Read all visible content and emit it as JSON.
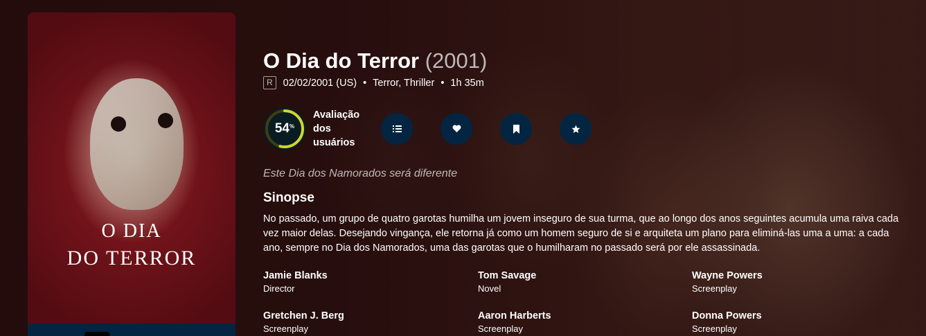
{
  "poster": {
    "title_line1": "O Dia",
    "title_line2": "do Terror"
  },
  "movie": {
    "title": "O Dia do Terror",
    "year": "(2001)",
    "certification": "R",
    "release": "02/02/2001 (US)",
    "genres": "Terror, Thriller",
    "runtime": "1h 35m",
    "separator": "•"
  },
  "score": {
    "value": 54,
    "unit": "%",
    "label": "Avaliação dos usuários",
    "ring_color": "#d2d531",
    "track_color": "#423d0f"
  },
  "actions": {
    "list_icon": "list-icon",
    "favorite_icon": "heart-icon",
    "watchlist_icon": "bookmark-icon",
    "rate_icon": "star-icon"
  },
  "tagline": "Este Dia dos Namorados será diferente",
  "overview": {
    "heading": "Sinopse",
    "text": "No passado, um grupo de quatro garotas humilha um jovem inseguro de sua turma, que ao longo dos anos seguintes acumula uma raiva cada vez maior delas. Desejando vingança, ele retorna já como um homem seguro de si e arquiteta um plano para eliminá-las uma a uma: a cada ano, sempre no Dia dos Namorados, uma das garotas que o humilharam no passado será por ele assassinada."
  },
  "crew": [
    {
      "name": "Jamie Blanks",
      "job": "Director"
    },
    {
      "name": "Tom Savage",
      "job": "Novel"
    },
    {
      "name": "Wayne Powers",
      "job": "Screenplay"
    },
    {
      "name": "Gretchen J. Berg",
      "job": "Screenplay"
    },
    {
      "name": "Aaron Harberts",
      "job": "Screenplay"
    },
    {
      "name": "Donna Powers",
      "job": "Screenplay"
    }
  ]
}
